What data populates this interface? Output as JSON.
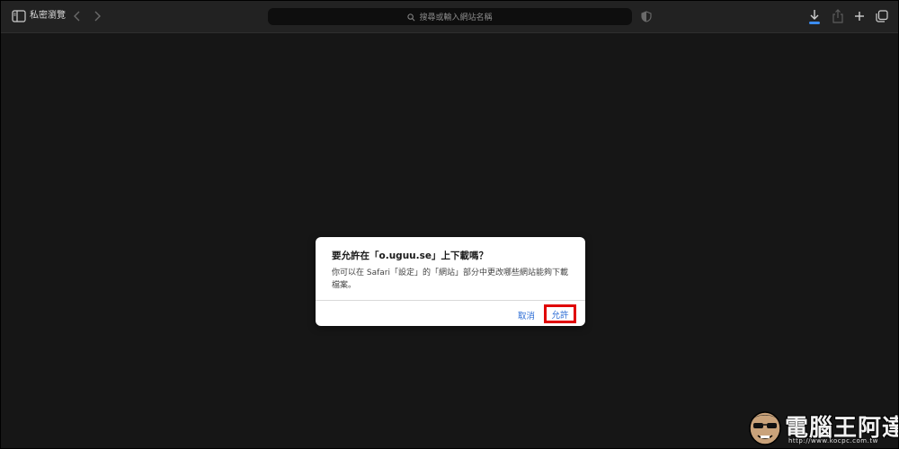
{
  "toolbar": {
    "private_label": "私密瀏覽",
    "address_placeholder": "搜尋或輸入網站名稱"
  },
  "icons": {
    "sidebar": "sidebar-icon",
    "back": "chevron-left-icon",
    "forward": "chevron-right-icon",
    "search": "search-icon",
    "privacy": "shield-icon",
    "download": "download-icon",
    "share": "share-icon",
    "new_tab": "plus-icon",
    "tabs": "tabs-overview-icon"
  },
  "dialog": {
    "title": "要允許在「o.uguu.se」上下載嗎？",
    "message": "你可以在 Safari「設定」的「網站」部分中更改哪些網站能夠下載檔案。",
    "cancel_label": "取消",
    "allow_label": "允許"
  },
  "watermark": {
    "brand": "電腦王阿達",
    "url": "http://www.kocpc.com.tw"
  },
  "colors": {
    "accent_blue": "#2f6fd6",
    "highlight_red": "#e00000",
    "download_blue": "#3b8cf0"
  }
}
